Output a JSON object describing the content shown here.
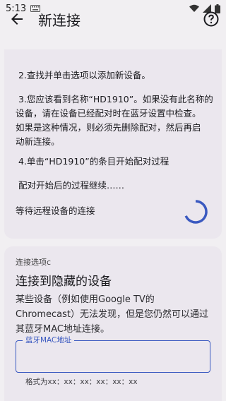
{
  "status_bar": {
    "time": "5:13",
    "icons": [
      "keyboard-icon",
      "wifi-icon",
      "signal-icon",
      "battery-icon"
    ]
  },
  "app_bar": {
    "title": "新连接",
    "back_icon": "arrow-back-icon",
    "help_icon": "help-icon"
  },
  "steps": {
    "step2": "2.查找并单击选项以添加新设备。",
    "step3_line1": "3.您应该看到名称“HD1910”。如果没有此名称的",
    "step3_line2": "设备，请在设备已经配对时在蓝牙设置中检查。",
    "step3_line3": "如果是这种情况，则必须先删除配对，然后再启",
    "step3_line4": "动新连接。",
    "step4": "4.单击“HD1910”的条目开始配对过程",
    "continue": "配对开始后的过程继续……",
    "waiting": "等待远程设备的连接"
  },
  "option_c": {
    "label": "连接选项c",
    "title": "连接到隐藏的设备",
    "desc_line1": "某些设备（例如使用Google TV的",
    "desc_line2": "Chromecast）无法发现，但是您仍然可以通过",
    "desc_line3": "其蓝牙MAC地址连接。",
    "field_label": "蓝牙MAC地址",
    "field_value": "",
    "format_hint": "格式为xx：xx：xx：xx：xx：xx"
  },
  "colors": {
    "accent": "#3a59c0",
    "card": "#ebe7ee",
    "background": "#f1eff2",
    "spinner": "#3a59c0"
  }
}
